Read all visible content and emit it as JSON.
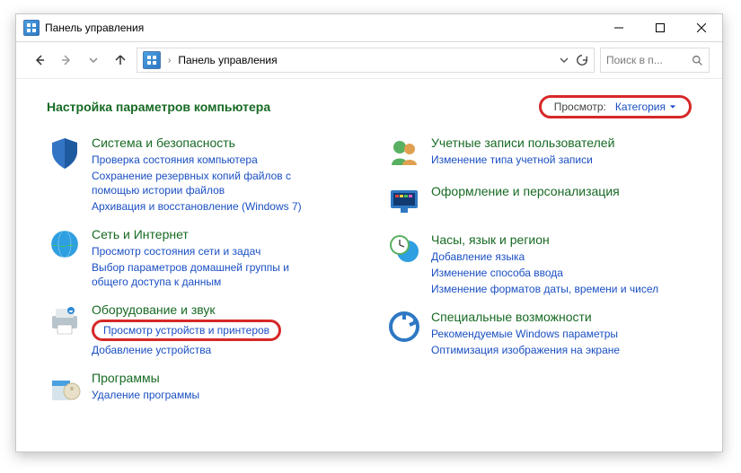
{
  "window": {
    "title": "Панель управления"
  },
  "breadcrumb": {
    "root": "Панель управления"
  },
  "search": {
    "placeholder": "Поиск в п..."
  },
  "heading": "Настройка параметров компьютера",
  "viewby": {
    "label": "Просмотр:",
    "value": "Категория"
  },
  "left": [
    {
      "title": "Система и безопасность",
      "links": [
        "Проверка состояния компьютера",
        "Сохранение резервных копий файлов с помощью истории файлов",
        "Архивация и восстановление (Windows 7)"
      ]
    },
    {
      "title": "Сеть и Интернет",
      "links": [
        "Просмотр состояния сети и задач",
        "Выбор параметров домашней группы и общего доступа к данным"
      ]
    },
    {
      "title": "Оборудование и звук",
      "highlight_link": "Просмотр устройств и принтеров",
      "links": [
        "Добавление устройства"
      ]
    },
    {
      "title": "Программы",
      "links": [
        "Удаление программы"
      ]
    }
  ],
  "right": [
    {
      "title": "Учетные записи пользователей",
      "links": [
        "Изменение типа учетной записи"
      ]
    },
    {
      "title": "Оформление и персонализация",
      "links": []
    },
    {
      "title": "Часы, язык и регион",
      "links": [
        "Добавление языка",
        "Изменение способа ввода",
        "Изменение форматов даты, времени и чисел"
      ]
    },
    {
      "title": "Специальные возможности",
      "links": [
        "Рекомендуемые Windows параметры",
        "Оптимизация изображения на экране"
      ]
    }
  ]
}
